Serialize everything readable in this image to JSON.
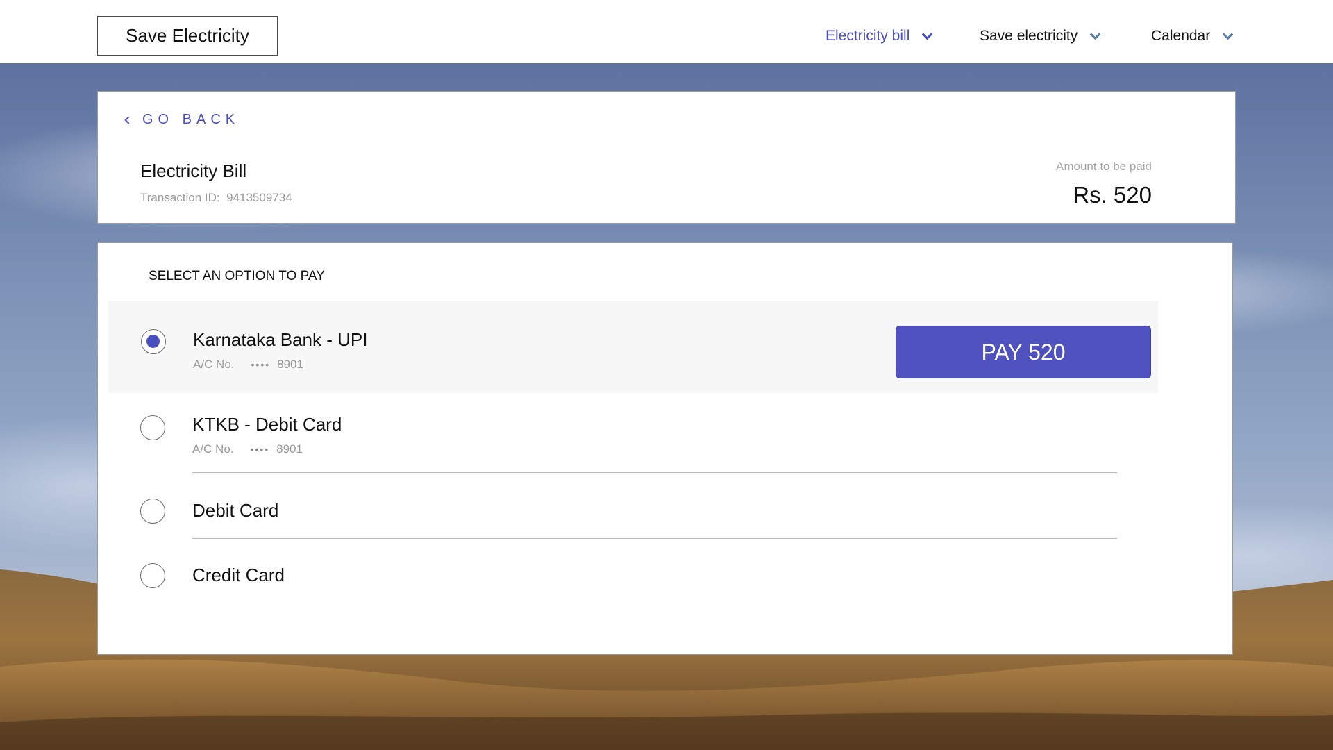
{
  "brand": "Save Electricity",
  "nav": [
    {
      "label": "Electricity bill",
      "active": true
    },
    {
      "label": "Save electricity",
      "active": false
    },
    {
      "label": "Calendar",
      "active": false
    }
  ],
  "header": {
    "go_back": "GO BACK",
    "bill_title": "Electricity Bill",
    "transaction_label": "Transaction ID:",
    "transaction_id": "9413509734",
    "amount_label": "Amount to be paid",
    "amount_value": "Rs. 520"
  },
  "payment": {
    "heading": "SELECT AN OPTION TO PAY",
    "options": [
      {
        "title": "Karnataka Bank - UPI",
        "acc_label": "A/C No.",
        "acc_mask": "••••",
        "acc_last": "8901",
        "selected": true
      },
      {
        "title": "KTKB - Debit Card",
        "acc_label": "A/C No.",
        "acc_mask": "••••",
        "acc_last": "8901",
        "selected": false
      },
      {
        "title": "Debit Card",
        "selected": false
      },
      {
        "title": "Credit Card",
        "selected": false
      }
    ],
    "pay_button": "PAY 520"
  },
  "colors": {
    "accent": "#4f51bf",
    "link": "#4a4fbf",
    "muted_text": "#9a9a9a"
  },
  "icons": [
    "chevron-down-icon",
    "chevron-left-icon",
    "radio-selected-icon",
    "radio-unselected-icon"
  ]
}
